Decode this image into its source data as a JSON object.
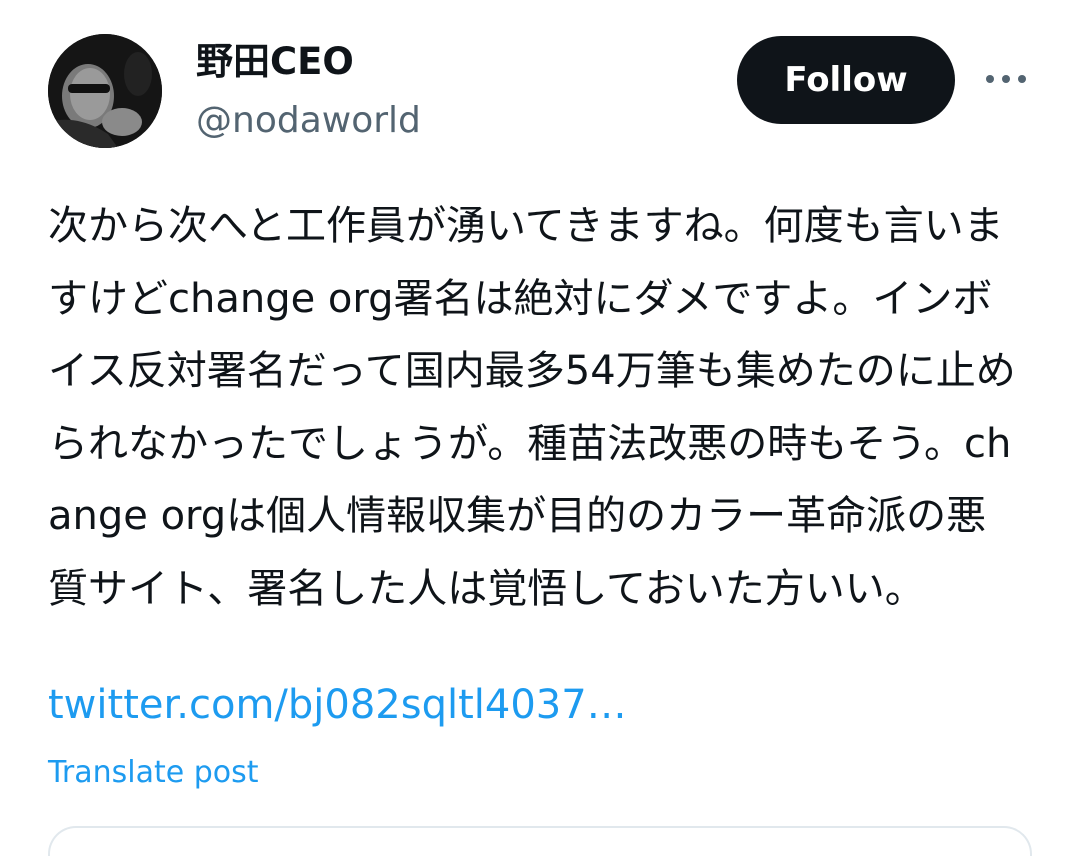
{
  "author": {
    "display_name": "野田CEO",
    "handle": "@nodaworld",
    "avatar_icon": "profile-photo"
  },
  "actions": {
    "follow_label": "Follow",
    "more_icon": "more-horizontal-icon"
  },
  "post": {
    "text": "次から次へと工作員が湧いてきますね。何度も言いますけどchange org署名は絶対にダメですよ。インボイス反対署名だって国内最多54万筆も集めたのに止められなかったでしょうが。種苗法改悪の時もそう。change orgは個人情報収集が目的のカラー革命派の悪質サイト、署名した人は覚悟しておいた方いい。",
    "link_text": "twitter.com/bj082sqltl4037…",
    "translate_label": "Translate post"
  },
  "colors": {
    "text": "#0f1419",
    "secondary": "#536471",
    "link": "#1d9bf0",
    "button_bg": "#0f1419",
    "button_text": "#ffffff",
    "border": "#e1e8ed"
  }
}
